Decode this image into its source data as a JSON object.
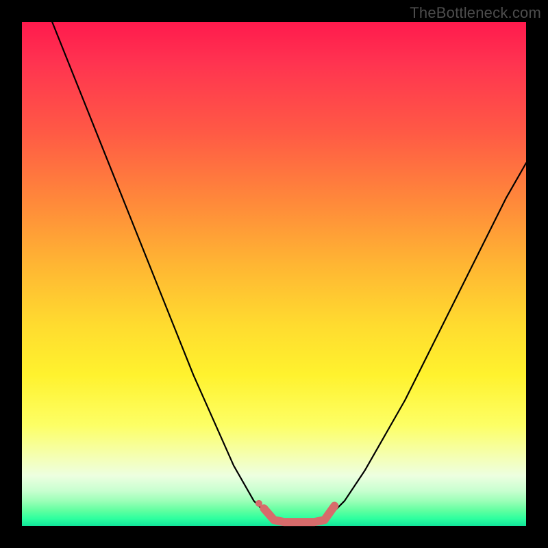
{
  "watermark": "TheBottleneck.com",
  "chart_data": {
    "type": "line",
    "title": "",
    "xlabel": "",
    "ylabel": "",
    "xlim": [
      0,
      100
    ],
    "ylim": [
      0,
      100
    ],
    "series": [
      {
        "name": "left-curve",
        "stroke": "#000000",
        "stroke_width": 2.2,
        "x": [
          6,
          10,
          14,
          18,
          22,
          26,
          30,
          34,
          38,
          42,
          46,
          50
        ],
        "y": [
          100,
          90,
          80,
          70,
          60,
          50,
          40,
          30,
          21,
          12,
          5,
          1
        ]
      },
      {
        "name": "right-curve",
        "stroke": "#000000",
        "stroke_width": 2.2,
        "x": [
          60,
          64,
          68,
          72,
          76,
          80,
          84,
          88,
          92,
          96,
          100
        ],
        "y": [
          1,
          5,
          11,
          18,
          25,
          33,
          41,
          49,
          57,
          65,
          72
        ]
      },
      {
        "name": "bottom-segment",
        "stroke": "#d76b6b",
        "stroke_width": 12,
        "x": [
          48,
          50,
          52,
          54,
          56,
          58,
          60,
          62
        ],
        "y": [
          3.5,
          1.2,
          0.8,
          0.8,
          0.8,
          0.8,
          1.2,
          4.0
        ]
      }
    ],
    "markers": [
      {
        "name": "left-dot",
        "x": 47,
        "y": 4.5,
        "r": 5,
        "fill": "#d76b6b"
      }
    ]
  }
}
